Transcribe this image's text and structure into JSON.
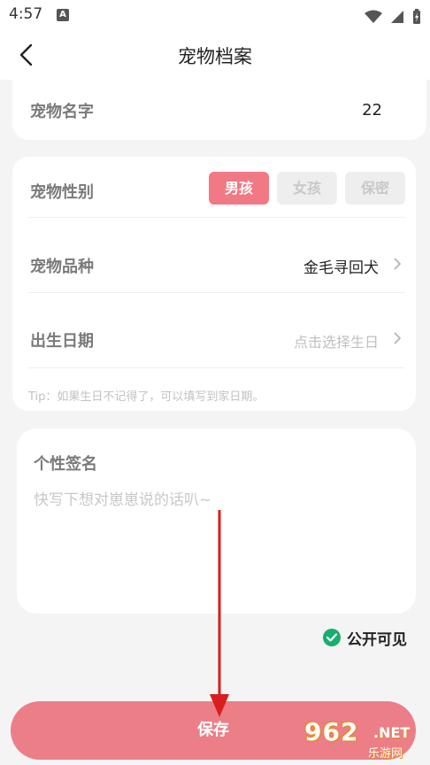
{
  "status_bar": {
    "time": "4:57",
    "app_icon_letter": "A"
  },
  "header": {
    "title": "宠物档案",
    "back_icon": "chevron-left-icon"
  },
  "pet_name": {
    "label": "宠物名字",
    "value": "22"
  },
  "gender": {
    "label": "宠物性别",
    "options": [
      {
        "label": "男孩",
        "selected": true
      },
      {
        "label": "女孩",
        "selected": false
      },
      {
        "label": "保密",
        "selected": false
      }
    ]
  },
  "breed": {
    "label": "宠物品种",
    "value": "金毛寻回犬"
  },
  "birthday": {
    "label": "出生日期",
    "placeholder": "点击选择生日"
  },
  "tip": "Tip：如果生日不记得了，可以填写到家日期。",
  "signature": {
    "label": "个性签名",
    "placeholder": "快写下想对崽崽说的话叭~"
  },
  "visibility": {
    "label": "公开可见",
    "checked": true
  },
  "save_button": "保存",
  "watermark": {
    "logo": "962",
    "net": ".NET",
    "sub": "乐游网"
  },
  "colors": {
    "accent": "#f07984",
    "save": "#ec7e88",
    "check": "#1aad6e",
    "arrow": "#d81e1e"
  }
}
